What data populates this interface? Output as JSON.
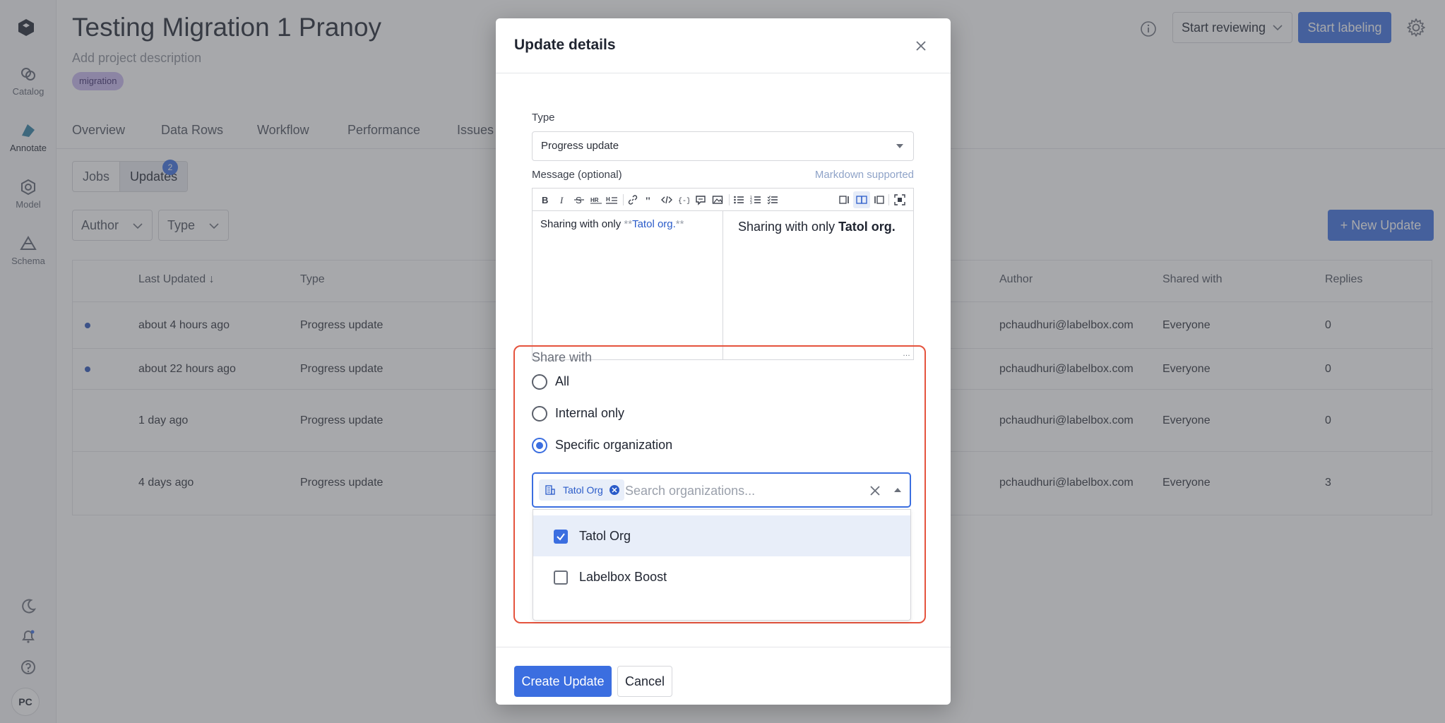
{
  "rail": {
    "items": [
      {
        "label": "Catalog",
        "icon": "catalog-icon"
      },
      {
        "label": "Annotate",
        "icon": "annotate-icon"
      },
      {
        "label": "Model",
        "icon": "model-icon"
      },
      {
        "label": "Schema",
        "icon": "schema-icon"
      }
    ],
    "avatar": "PC"
  },
  "header": {
    "title": "Testing Migration 1 Pranoy",
    "description_placeholder": "Add project description",
    "tag": "migration",
    "review_label": "Start reviewing",
    "label_label": "Start labeling"
  },
  "tabs": [
    "Overview",
    "Data Rows",
    "Workflow",
    "Performance",
    "Issues"
  ],
  "segments": {
    "jobs": "Jobs",
    "updates": "Updates",
    "badge": "2"
  },
  "filters": {
    "author": "Author",
    "type": "Type"
  },
  "new_update_label": "+ New Update",
  "table": {
    "headers": {
      "last_updated": "Last Updated",
      "type": "Type",
      "author": "Author",
      "shared_with": "Shared with",
      "replies": "Replies"
    },
    "rows": [
      {
        "time": "about 4 hours ago",
        "type": "Progress update",
        "author": "pchaudhuri@labelbox.com",
        "shared": "Everyone",
        "replies": "0",
        "unread": true
      },
      {
        "time": "about 22 hours ago",
        "type": "Progress update",
        "author": "pchaudhuri@labelbox.com",
        "shared": "Everyone",
        "replies": "0",
        "unread": true
      },
      {
        "time": "1 day ago",
        "type": "Progress update",
        "author": "pchaudhuri@labelbox.com",
        "shared": "Everyone",
        "replies": "0",
        "unread": false
      },
      {
        "time": "4 days ago",
        "type": "Progress update",
        "author": "pchaudhuri@labelbox.com",
        "shared": "Everyone",
        "replies": "3",
        "unread": false
      }
    ]
  },
  "modal": {
    "title": "Update details",
    "type_label": "Type",
    "type_value": "Progress update",
    "message_label": "Message (optional)",
    "markdown_hint": "Markdown supported",
    "editor": {
      "source_prefix": "Sharing with only ",
      "source_mark_open": "**",
      "source_bold": "Tatol org.",
      "source_mark_close": "**",
      "preview_prefix": "Sharing with only ",
      "preview_bold": "Tatol org."
    },
    "share_with_label": "Share with",
    "share_options": [
      {
        "label": "All",
        "selected": false
      },
      {
        "label": "Internal only",
        "selected": false
      },
      {
        "label": "Specific organization",
        "selected": true
      }
    ],
    "org_chip": "Tatol Org",
    "org_search_placeholder": "Search organizations...",
    "org_options": [
      {
        "label": "Tatol Org",
        "checked": true
      },
      {
        "label": "Labelbox Boost",
        "checked": false
      }
    ],
    "create_label": "Create Update",
    "cancel_label": "Cancel"
  },
  "colors": {
    "accent": "#3b6ee0",
    "highlight_border": "#e5533d",
    "tag_bg": "#c9b8f0"
  }
}
